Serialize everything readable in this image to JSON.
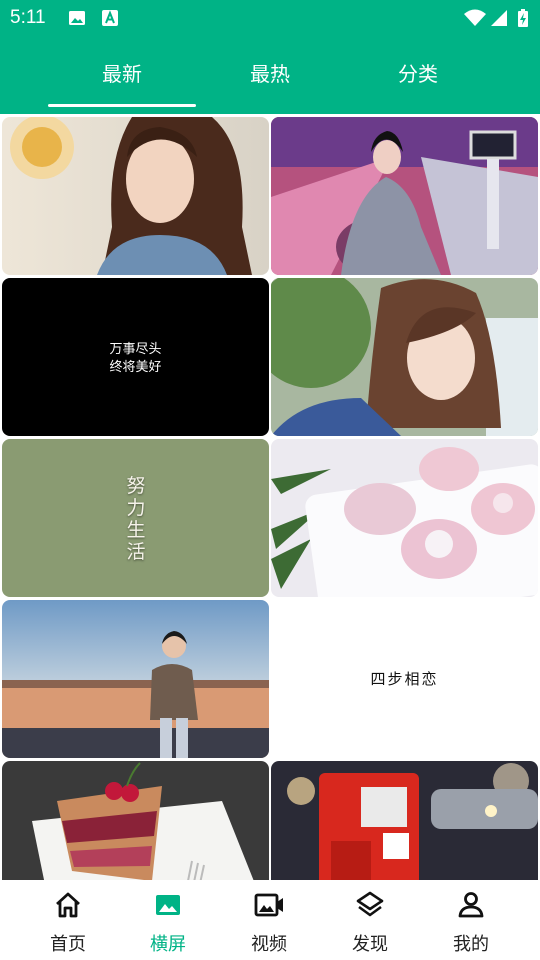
{
  "status": {
    "time": "5:11"
  },
  "tabs": [
    {
      "label": "最新",
      "active": true
    },
    {
      "label": "最热",
      "active": false
    },
    {
      "label": "分类",
      "active": false
    }
  ],
  "tiles": [
    {
      "kind": "photo",
      "name": "girl-portrait-cafe"
    },
    {
      "kind": "photo",
      "name": "bowling-alley-model"
    },
    {
      "kind": "quote",
      "line1": "万事尽头",
      "line2": "终将美好"
    },
    {
      "kind": "photo",
      "name": "girl-portrait-striped-shirt"
    },
    {
      "kind": "vertical-text",
      "text": "努力生活"
    },
    {
      "kind": "photo",
      "name": "pink-mooncakes"
    },
    {
      "kind": "photo",
      "name": "man-rooftop-sunset"
    },
    {
      "kind": "quote",
      "text": "四步相恋"
    },
    {
      "kind": "photo",
      "name": "berry-cake"
    },
    {
      "kind": "photo",
      "name": "red-postbox-night"
    }
  ],
  "nav": [
    {
      "label": "首页",
      "icon": "home-icon",
      "active": false
    },
    {
      "label": "横屏",
      "icon": "image-icon",
      "active": true
    },
    {
      "label": "视频",
      "icon": "video-icon",
      "active": false
    },
    {
      "label": "发现",
      "icon": "layers-icon",
      "active": false
    },
    {
      "label": "我的",
      "icon": "person-icon",
      "active": false
    }
  ],
  "colors": {
    "primary": "#00b386",
    "text": "#222222"
  }
}
